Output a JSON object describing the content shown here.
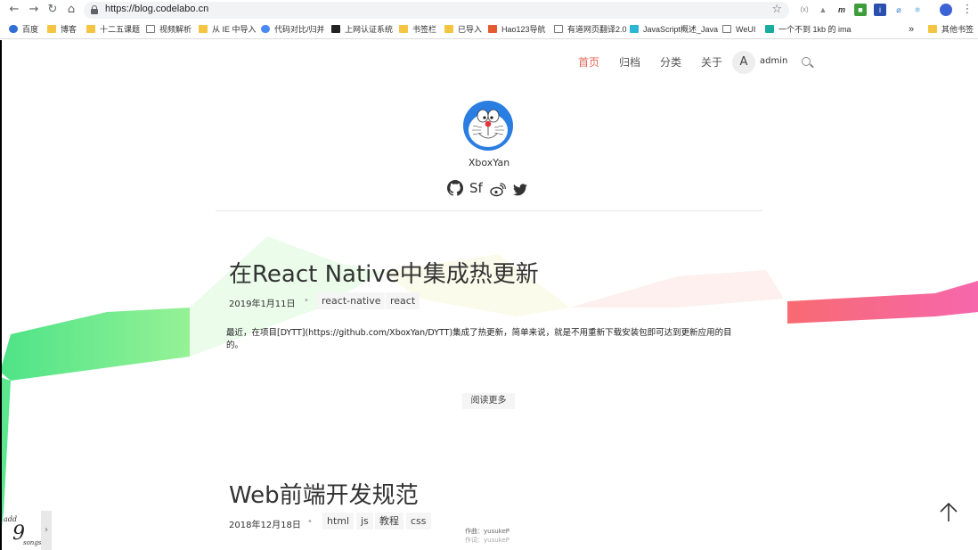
{
  "browser": {
    "url": "https://blog.codelabo.cn",
    "bookmarks": [
      {
        "label": "百度",
        "type": "page"
      },
      {
        "label": "博客",
        "type": "folder"
      },
      {
        "label": "十二五课题",
        "type": "folder"
      },
      {
        "label": "视频解析",
        "type": "page"
      },
      {
        "label": "从 IE 中导入",
        "type": "folder"
      },
      {
        "label": "代码对比/归并",
        "type": "page"
      },
      {
        "label": "上网认证系统",
        "type": "page"
      },
      {
        "label": "书签栏",
        "type": "folder"
      },
      {
        "label": "已导入",
        "type": "folder"
      },
      {
        "label": "Hao123导航",
        "type": "page"
      },
      {
        "label": "有道网页翻译2.0",
        "type": "page"
      },
      {
        "label": "JavaScript概述_Java",
        "type": "page"
      },
      {
        "label": "WeUI",
        "type": "page"
      },
      {
        "label": "一个不到 1kb 的 ima",
        "type": "page"
      }
    ],
    "overflow_label": "»",
    "other_bookmarks": "其他书签"
  },
  "site": {
    "nav": [
      "首页",
      "归档",
      "分类",
      "关于"
    ],
    "user_initial": "A",
    "user_name": "admin",
    "author": "XboxYan",
    "social": [
      "github-icon",
      "segmentfault-icon",
      "weibo-icon",
      "twitter-icon"
    ],
    "sf_label": "Sf"
  },
  "posts": [
    {
      "title": "在React Native中集成热更新",
      "date": "2019年1月11日",
      "tags": [
        "react-native",
        "react"
      ],
      "excerpt": "最近，在项目[DYTT](https://github.com/XboxYan/DYTT)集成了热更新，简单来说，就是不用重新下载安装包即可达到更新应用的目的。",
      "read_more": "阅读更多"
    },
    {
      "title": "Web前端开发规范",
      "date": "2018年12月18日",
      "tags": [
        "html",
        "js",
        "教程",
        "css"
      ]
    }
  ],
  "music": {
    "credit_line1": "作曲：yusukeP",
    "credit_line2": "作词：yusukeP"
  },
  "colors": {
    "accent": "#e6675b",
    "ribbon_green": "#5de87e",
    "ribbon_pink": "#f7637a"
  }
}
